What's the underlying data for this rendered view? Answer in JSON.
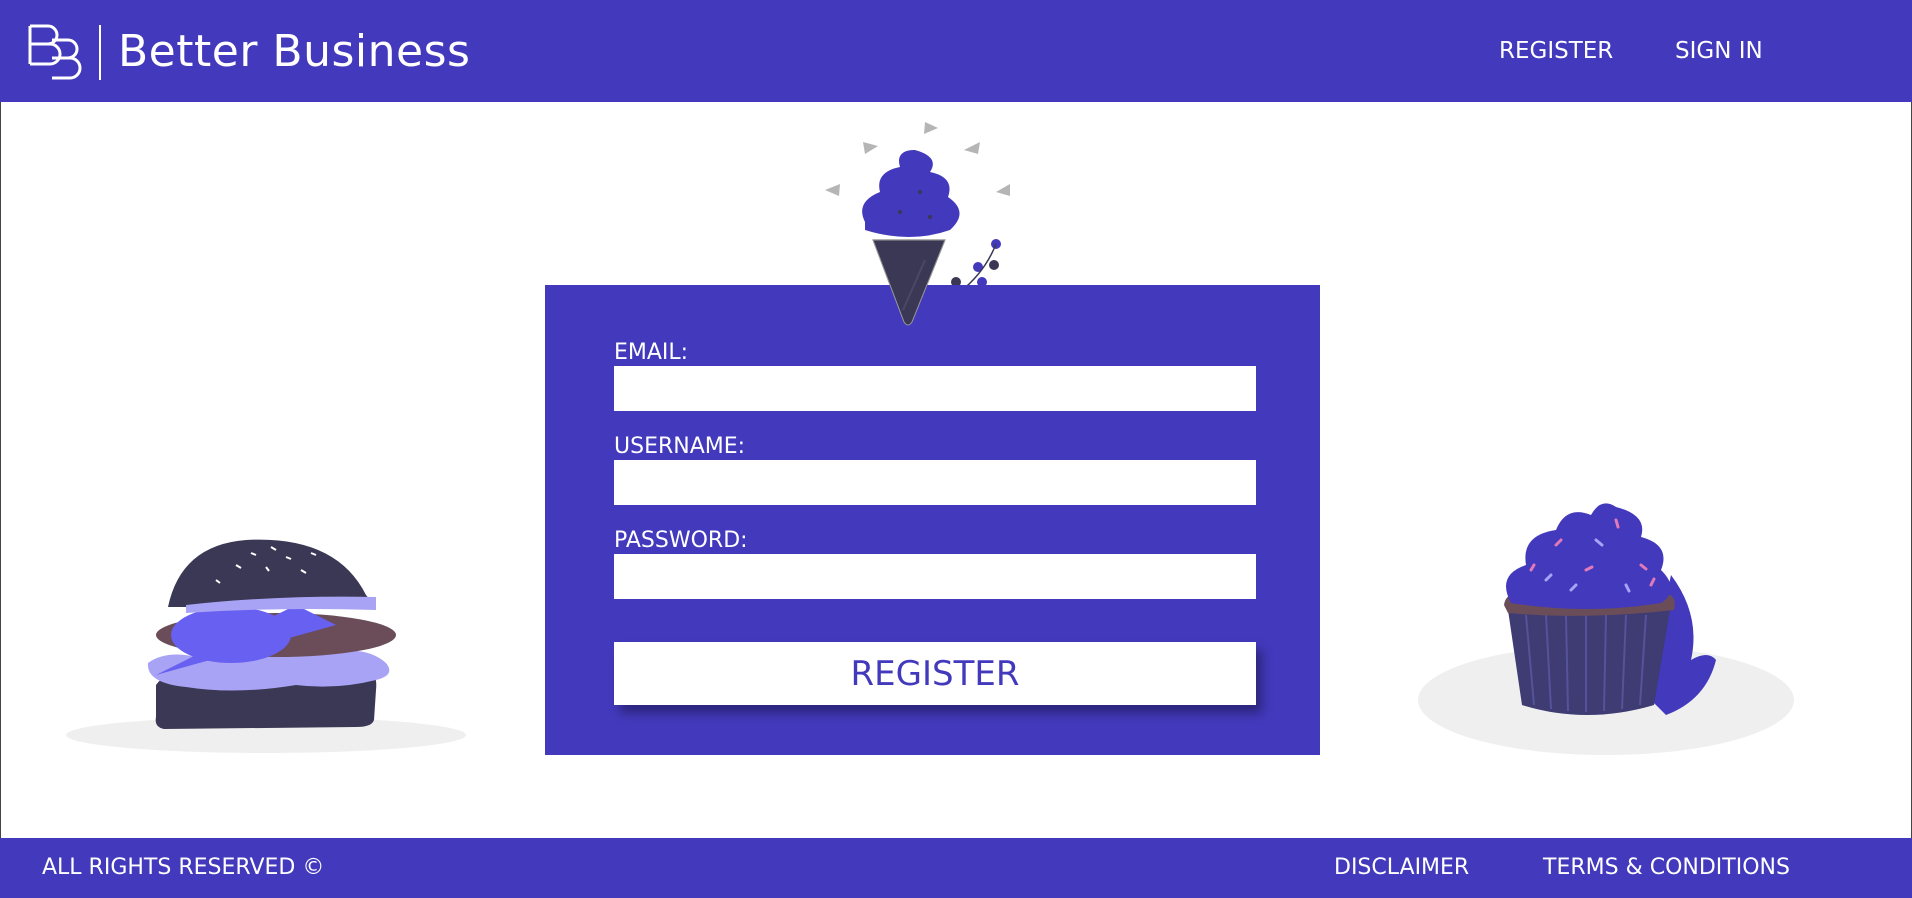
{
  "header": {
    "brand": "Better Business",
    "nav": [
      {
        "label": "REGISTER"
      },
      {
        "label": "SIGN IN"
      }
    ]
  },
  "form": {
    "email_label": "EMAIL:",
    "username_label": "USERNAME:",
    "password_label": "PASSWORD:",
    "email_value": "",
    "username_value": "",
    "password_value": "",
    "submit_label": "REGISTER"
  },
  "illustrations": {
    "left": "burger-illustration",
    "center": "ice-cream-illustration",
    "right": "cupcake-illustration"
  },
  "footer": {
    "copyright": "ALL RIGHTS RESERVED ©",
    "links": [
      {
        "label": "DISCLAIMER"
      },
      {
        "label": "TERMS & CONDITIONS"
      }
    ]
  },
  "colors": {
    "primary": "#4339bc",
    "white": "#ffffff",
    "dark": "#3a3854",
    "lavender": "#a9a3f5"
  }
}
